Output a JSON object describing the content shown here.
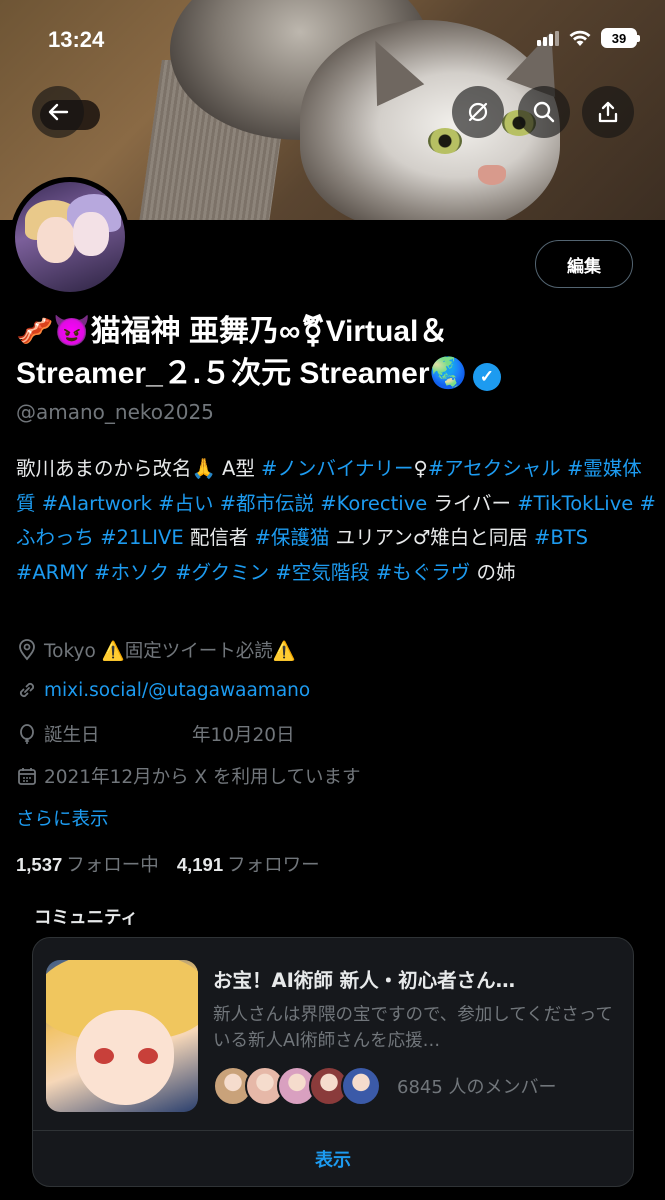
{
  "status_bar": {
    "time": "13:24",
    "battery": "39"
  },
  "header": {
    "icons": [
      "back-arrow-icon",
      "grok-icon",
      "search-icon",
      "share-icon"
    ]
  },
  "profile": {
    "edit_label": "編集",
    "name_line1": "🥓😈猫福神 亜舞乃∞⚧Virtual＆",
    "name_line2": "Streamer_２.５次元 Streamer🌏",
    "handle": "@amano_neko2025",
    "verified_color": "#1d9bf0",
    "bio": [
      {
        "text": "歌川あまのから改名🙏 A型 ",
        "tag": false
      },
      {
        "text": "#ノンバイナリー",
        "tag": true
      },
      {
        "text": "♀",
        "tag": false
      },
      {
        "text": "#アセクシャル",
        "tag": true
      },
      {
        "text": " ",
        "tag": false
      },
      {
        "text": "#霊媒体質",
        "tag": true
      },
      {
        "text": " ",
        "tag": false
      },
      {
        "text": "#AIartwork",
        "tag": true
      },
      {
        "text": " ",
        "tag": false
      },
      {
        "text": "#占い",
        "tag": true
      },
      {
        "text": " ",
        "tag": false
      },
      {
        "text": "#都市伝説",
        "tag": true
      },
      {
        "text": " ",
        "tag": false
      },
      {
        "text": "#Korective",
        "tag": true
      },
      {
        "text": " ライバー ",
        "tag": false
      },
      {
        "text": "#TikTokLive",
        "tag": true
      },
      {
        "text": " ",
        "tag": false
      },
      {
        "text": "#ふわっち",
        "tag": true
      },
      {
        "text": " ",
        "tag": false
      },
      {
        "text": "#21LIVE",
        "tag": true
      },
      {
        "text": " 配信者 ",
        "tag": false
      },
      {
        "text": "#保護猫",
        "tag": true
      },
      {
        "text": " ユリアン♂雉白と同居 ",
        "tag": false
      },
      {
        "text": "#BTS",
        "tag": true
      },
      {
        "text": " ",
        "tag": false
      },
      {
        "text": "#ARMY",
        "tag": true
      },
      {
        "text": " ",
        "tag": false
      },
      {
        "text": "#ホソク",
        "tag": true
      },
      {
        "text": " ",
        "tag": false
      },
      {
        "text": "#グクミン",
        "tag": true
      },
      {
        "text": " ",
        "tag": false
      },
      {
        "text": "#空気階段",
        "tag": true
      },
      {
        "text": " ",
        "tag": false
      },
      {
        "text": "#もぐラヴ",
        "tag": true
      },
      {
        "text": " の姉",
        "tag": false
      }
    ],
    "location": "Tokyo ⚠️固定ツイート必読⚠️",
    "website": "mixi.social/@utagawaamano",
    "birthday": "誕生日　　　　　年10月20日",
    "joined": "2021年12月から X を利用しています",
    "show_more": "さらに表示",
    "following_count": "1,537",
    "following_label": "フォロー中",
    "followers_count": "4,191",
    "followers_label": "フォロワー"
  },
  "community": {
    "section_title": "コミュニティ",
    "title": "お宝！AI術師 新人・初心者さん…",
    "description": "新人さんは界隈の宝ですので、参加してくださっている新人AI術師さんを応援…",
    "member_count": "6845 人のメンバー",
    "view_label": "表示",
    "member_avatar_colors": [
      "#c9a27a",
      "#e6b8a8",
      "#d9a0c0",
      "#8a3b3b",
      "#3b5aa8"
    ]
  }
}
